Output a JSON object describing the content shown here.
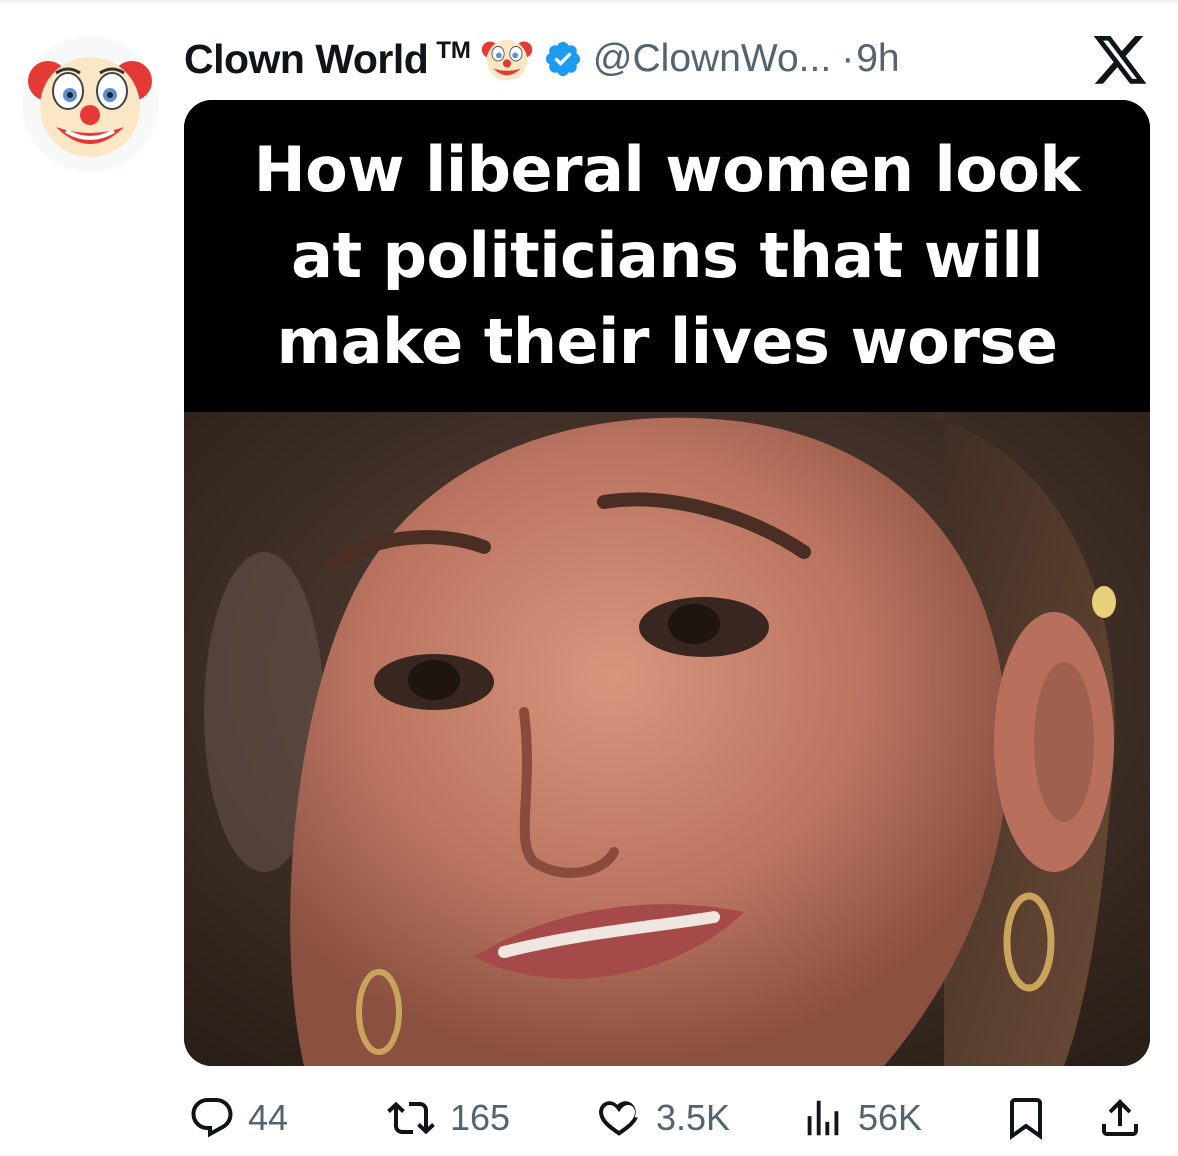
{
  "tweet": {
    "display_name": "Clown World",
    "trademark": "TM",
    "handle": "@ClownWo...",
    "separator": "·",
    "time": "9h",
    "verified": true,
    "media_caption": "How liberal women look\nat politicians that will\nmake their lives worse"
  },
  "stats": {
    "replies": "44",
    "reposts": "165",
    "likes": "3.5K",
    "views": "56K"
  },
  "icons": {
    "avatar": "clown-face-icon",
    "name_emoji": "clown-face-icon",
    "verified": "verified-badge-icon",
    "brand": "x-logo-icon",
    "reply": "reply-icon",
    "repost": "repost-icon",
    "like": "heart-icon",
    "views": "views-icon",
    "bookmark": "bookmark-icon",
    "share": "share-icon"
  },
  "colors": {
    "verified": "#1d9bf0",
    "secondary_text": "#536471",
    "caption_bg": "#000000",
    "caption_text": "#ffffff"
  }
}
